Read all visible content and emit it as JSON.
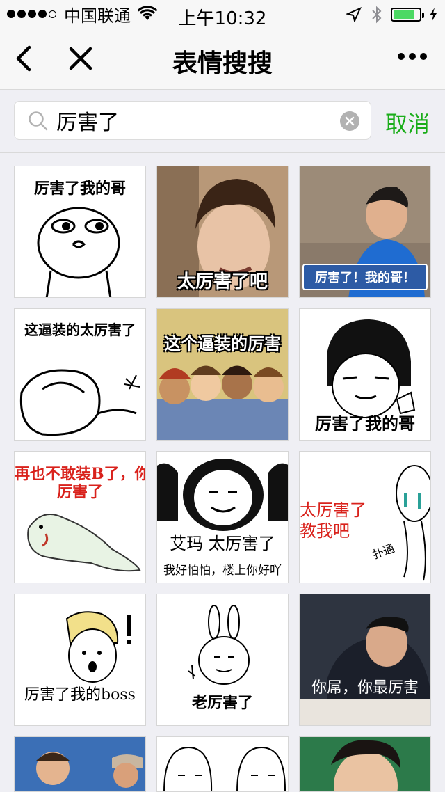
{
  "status_bar": {
    "carrier": "中国联通",
    "time": "上午10:32"
  },
  "nav": {
    "title": "表情搜搜"
  },
  "search": {
    "value": "厉害了",
    "cancel_label": "取消"
  },
  "colors": {
    "accent_green": "#1aad19",
    "battery_green": "#4cd964"
  },
  "results": [
    {
      "caption": "厉害了我的哥",
      "style": "white-cartoon"
    },
    {
      "caption": "太厉害了吧",
      "style": "photo"
    },
    {
      "caption": "厉害了！我的哥！",
      "style": "photo-banner"
    },
    {
      "caption": "这逼装的太厉害了",
      "style": "white-cartoon"
    },
    {
      "caption": "这个逼装的厉害",
      "style": "cartoon-color"
    },
    {
      "caption": "厉害了我的哥",
      "style": "white-cartoon"
    },
    {
      "caption": "再也不敢装B了，你",
      "caption2": "厉害了",
      "style": "white-cartoon-red"
    },
    {
      "caption": "艾玛 太厉害了",
      "caption2": "我好怕怕，楼上你好吖",
      "style": "panda"
    },
    {
      "caption": "太厉害了",
      "caption2": "教我吧",
      "side_label": "扑通",
      "style": "white-cartoon-red"
    },
    {
      "caption": "厉害了我的boss",
      "style": "white-cartoon"
    },
    {
      "caption": "老厉害了",
      "style": "white-cartoon"
    },
    {
      "caption": "你屌，你最厉害",
      "style": "photo"
    },
    {
      "caption": "",
      "style": "photo"
    },
    {
      "caption": "",
      "style": "white-cartoon"
    },
    {
      "caption": "",
      "style": "photo"
    }
  ]
}
